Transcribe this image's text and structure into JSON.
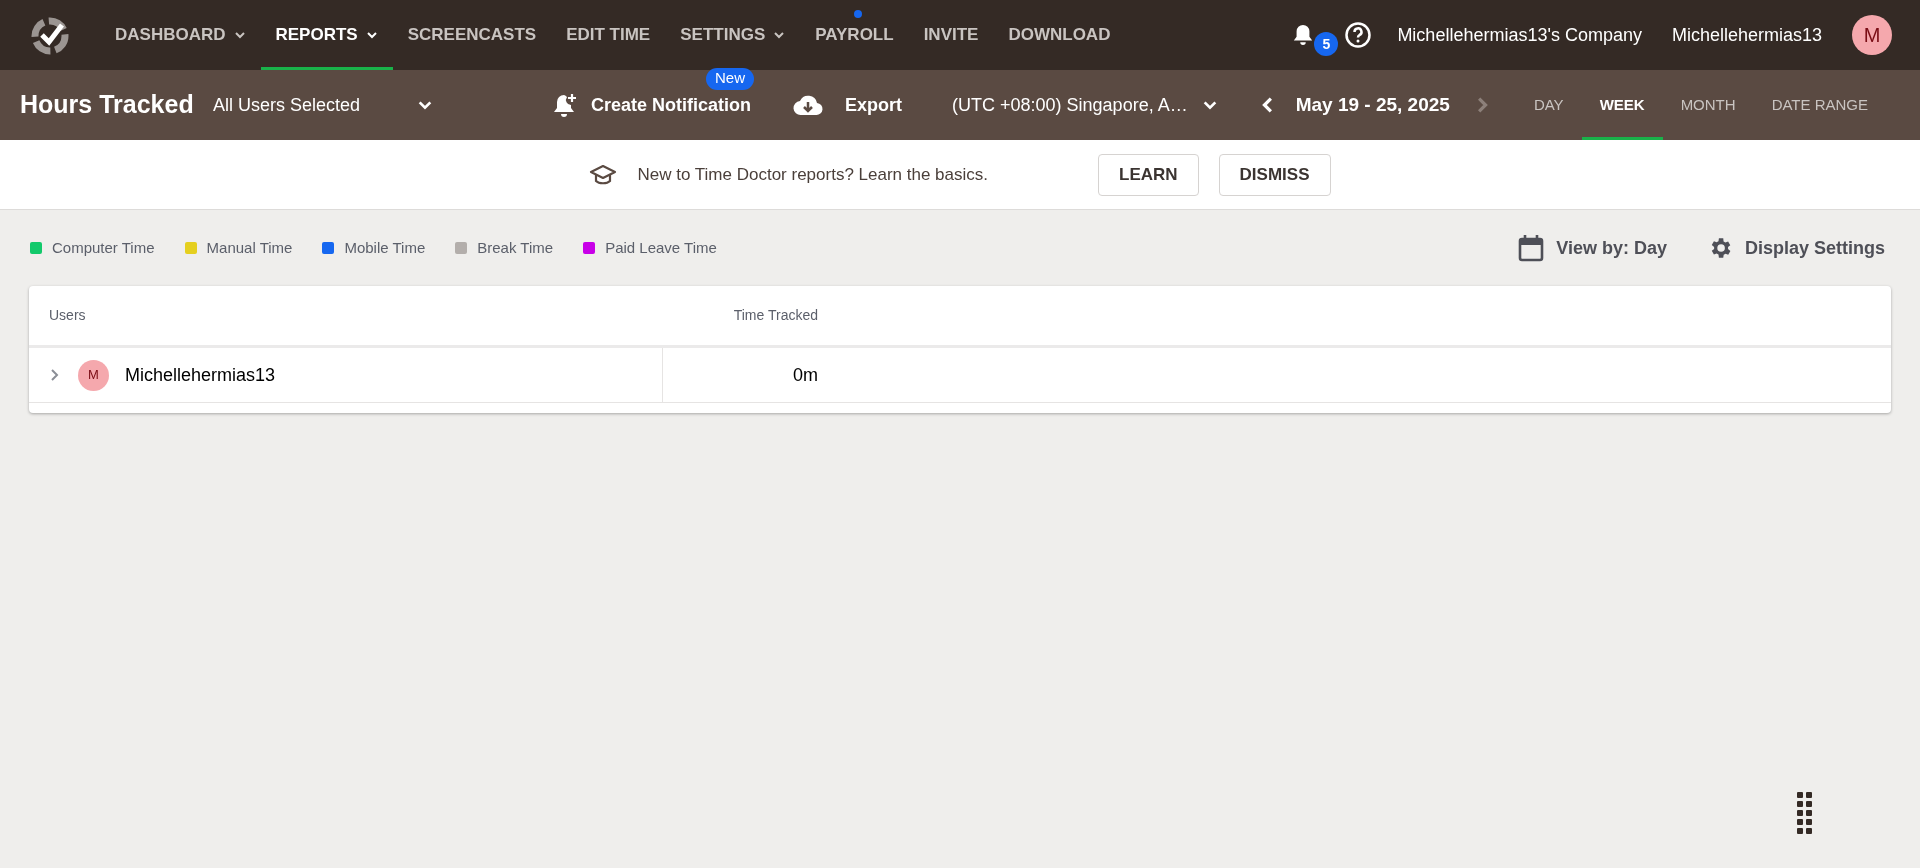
{
  "nav": {
    "items": [
      {
        "label": "DASHBOARD",
        "selected": false,
        "dropdown": true,
        "dot": false
      },
      {
        "label": "REPORTS",
        "selected": true,
        "dropdown": true,
        "dot": false
      },
      {
        "label": "SCREENCASTS",
        "selected": false,
        "dropdown": false,
        "dot": false
      },
      {
        "label": "EDIT TIME",
        "selected": false,
        "dropdown": false,
        "dot": false
      },
      {
        "label": "SETTINGS",
        "selected": false,
        "dropdown": true,
        "dot": false
      },
      {
        "label": "PAYROLL",
        "selected": false,
        "dropdown": false,
        "dot": true
      },
      {
        "label": "INVITE",
        "selected": false,
        "dropdown": false,
        "dot": false
      },
      {
        "label": "DOWNLOAD",
        "selected": false,
        "dropdown": false,
        "dot": false
      }
    ],
    "notification_count": "5",
    "company": "Michellehermias13's Company",
    "user": "Michellehermias13",
    "avatar": "M"
  },
  "toolbar": {
    "title": "Hours Tracked",
    "user_filter": "All Users Selected",
    "create_notification": "Create Notification",
    "new_badge": "New",
    "export": "Export",
    "timezone": "(UTC +08:00) Singapore, A…",
    "date_range": "May 19 - 25, 2025",
    "next_disabled": true,
    "ranges": [
      {
        "label": "DAY",
        "selected": false
      },
      {
        "label": "WEEK",
        "selected": true
      },
      {
        "label": "MONTH",
        "selected": false
      },
      {
        "label": "DATE RANGE",
        "selected": false
      }
    ]
  },
  "banner": {
    "text": "New to Time Doctor reports? Learn the basics.",
    "buttons": [
      "LEARN",
      "DISMISS"
    ]
  },
  "legend": [
    {
      "label": "Computer Time",
      "color": "#12c96b"
    },
    {
      "label": "Manual Time",
      "color": "#e5cf1f"
    },
    {
      "label": "Mobile Time",
      "color": "#1667f0"
    },
    {
      "label": "Break Time",
      "color": "#b3aeab"
    },
    {
      "label": "Paid Leave Time",
      "color": "#c800e8"
    }
  ],
  "view_by": "View by: Day",
  "display_settings": "Display Settings",
  "table": {
    "columns": [
      "Users",
      "Time Tracked"
    ],
    "rows": [
      {
        "avatar": "M",
        "user": "Michellehermias13",
        "time_tracked": "0m",
        "expanded": false
      }
    ]
  }
}
